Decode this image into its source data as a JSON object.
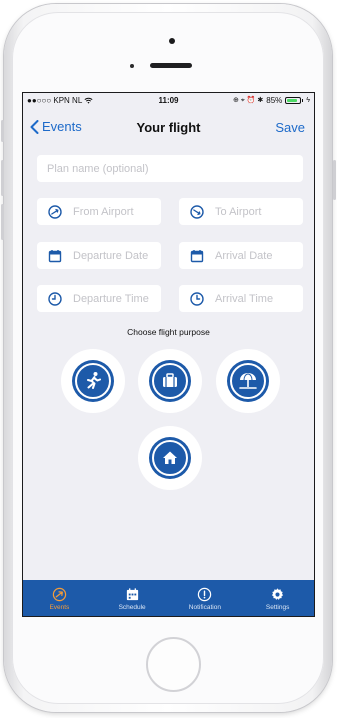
{
  "status_bar": {
    "carrier": "●●○○○ KPN NL",
    "time": "11:09",
    "right_indicators": "⊕ ⌖ ⏰ ✱",
    "battery_text": "85%",
    "battery_level": 0.85
  },
  "nav": {
    "back_label": "Events",
    "title": "Your flight",
    "save_label": "Save"
  },
  "form": {
    "plan_name_placeholder": "Plan name (optional)",
    "from_airport": "From Airport",
    "to_airport": "To Airport",
    "departure_date": "Departure Date",
    "arrival_date": "Arrival Date",
    "departure_time": "Departure Time",
    "arrival_time": "Arrival Time"
  },
  "purpose": {
    "title": "Choose flight purpose",
    "options": [
      {
        "icon": "running-icon"
      },
      {
        "icon": "briefcase-icon"
      },
      {
        "icon": "beach-umbrella-icon"
      },
      {
        "icon": "home-icon"
      }
    ]
  },
  "tabs": [
    {
      "label": "Events",
      "icon": "airplane-icon",
      "active": true
    },
    {
      "label": "Schedule",
      "icon": "calendar-icon",
      "active": false
    },
    {
      "label": "Notification",
      "icon": "alert-icon",
      "active": false
    },
    {
      "label": "Settings",
      "icon": "gear-icon",
      "active": false
    }
  ],
  "colors": {
    "accent": "#1d5aa9",
    "link": "#1d6ac9",
    "active_tab": "#f39c3a",
    "background": "#efeff4",
    "placeholder": "#c3c3c8"
  }
}
